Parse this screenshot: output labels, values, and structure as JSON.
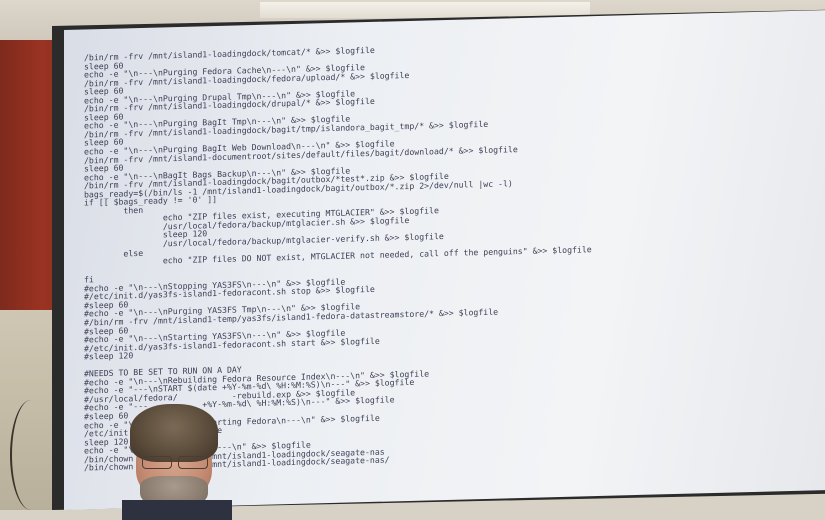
{
  "code_lines": [
    "/bin/rm -frv /mnt/island1-loadingdock/tomcat/* &>> $logfile",
    "sleep 60",
    "echo -e \"\\n---\\nPurging Fedora Cache\\n---\\n\" &>> $logfile",
    "/bin/rm -frv /mnt/island1-loadingdock/fedora/upload/* &>> $logfile",
    "sleep 60",
    "echo -e \"\\n---\\nPurging Drupal Tmp\\n---\\n\" &>> $logfile",
    "/bin/rm -frv /mnt/island1-loadingdock/drupal/* &>> $logfile",
    "sleep 60",
    "echo -e \"\\n---\\nPurging BagIt Tmp\\n---\\n\" &>> $logfile",
    "/bin/rm -frv /mnt/island1-loadingdock/bagit/tmp/islandora_bagit_tmp/* &>> $logfile",
    "sleep 60",
    "echo -e \"\\n---\\nPurging BagIt Web Download\\n---\\n\" &>> $logfile",
    "/bin/rm -frv /mnt/island1-documentroot/sites/default/files/bagit/download/* &>> $logfile",
    "sleep 60",
    "echo -e \"\\n---\\nBagIt Bags Backup\\n---\\n\" &>> $logfile",
    "/bin/rm -frv /mnt/island1-loadingdock/bagit/outbox/*test*.zip &>> $logfile",
    "bags_ready=$(/bin/ls -1 /mnt/island1-loadingdock/bagit/outbox/*.zip 2>/dev/null |wc -l)",
    "if [[ $bags_ready != '0' ]]",
    "        then",
    "                echo \"ZIP files exist, executing MTGLACIER\" &>> $logfile",
    "                /usr/local/fedora/backup/mtglacier.sh &>> $logfile",
    "                sleep 120",
    "                /usr/local/fedora/backup/mtglacier-verify.sh &>> $logfile",
    "        else",
    "                echo \"ZIP files DO NOT exist, MTGLACIER not needed, call off the penguins\" &>> $logfile",
    "",
    "fi",
    "#echo -e \"\\n---\\nStopping YAS3FS\\n---\\n\" &>> $logfile",
    "#/etc/init.d/yas3fs-island1-fedoracont.sh stop &>> $logfile",
    "#sleep 60",
    "#echo -e \"\\n---\\nPurging YAS3FS Tmp\\n---\\n\" &>> $logfile",
    "#/bin/rm -frv /mnt/island1-temp/yas3fs/island1-fedora-datastreamstore/* &>> $logfile",
    "#sleep 60",
    "#echo -e \"\\n---\\nStarting YAS3FS\\n---\\n\" &>> $logfile",
    "#/etc/init.d/yas3fs-island1-fedoracont.sh start &>> $logfile",
    "#sleep 120",
    "",
    "#NEEDS TO BE SET TO RUN ON A DAY",
    "#echo -e \"\\n---\\nRebuilding Fedora Resource Index\\n---\\n\" &>> $logfile",
    "#echo -e \"---\\nSTART $(date +%Y-%m-%d\\ %H:%M:%S)\\n---\" &>> $logfile",
    "#/usr/local/fedora/           -rebuild.exp &>> $logfile",
    "#echo -e \"---           +%Y-%m-%d\\ %H:%M:%S)\\n---\" &>> $logfile",
    "#sleep 60",
    "echo -e \"\\n-            Starting Fedora\\n---\\n\" &>> $logfile",
    "/etc/init.d/            file",
    "sleep 120",
    "echo -e \"\\n---           \\n---\\n\" &>> $logfile",
    "/bin/chown -R            /mnt/island1-loadingdock/seagate-nas",
    "/bin/chown -R            /mnt/island1-loadingdock/seagate-nas/"
  ]
}
